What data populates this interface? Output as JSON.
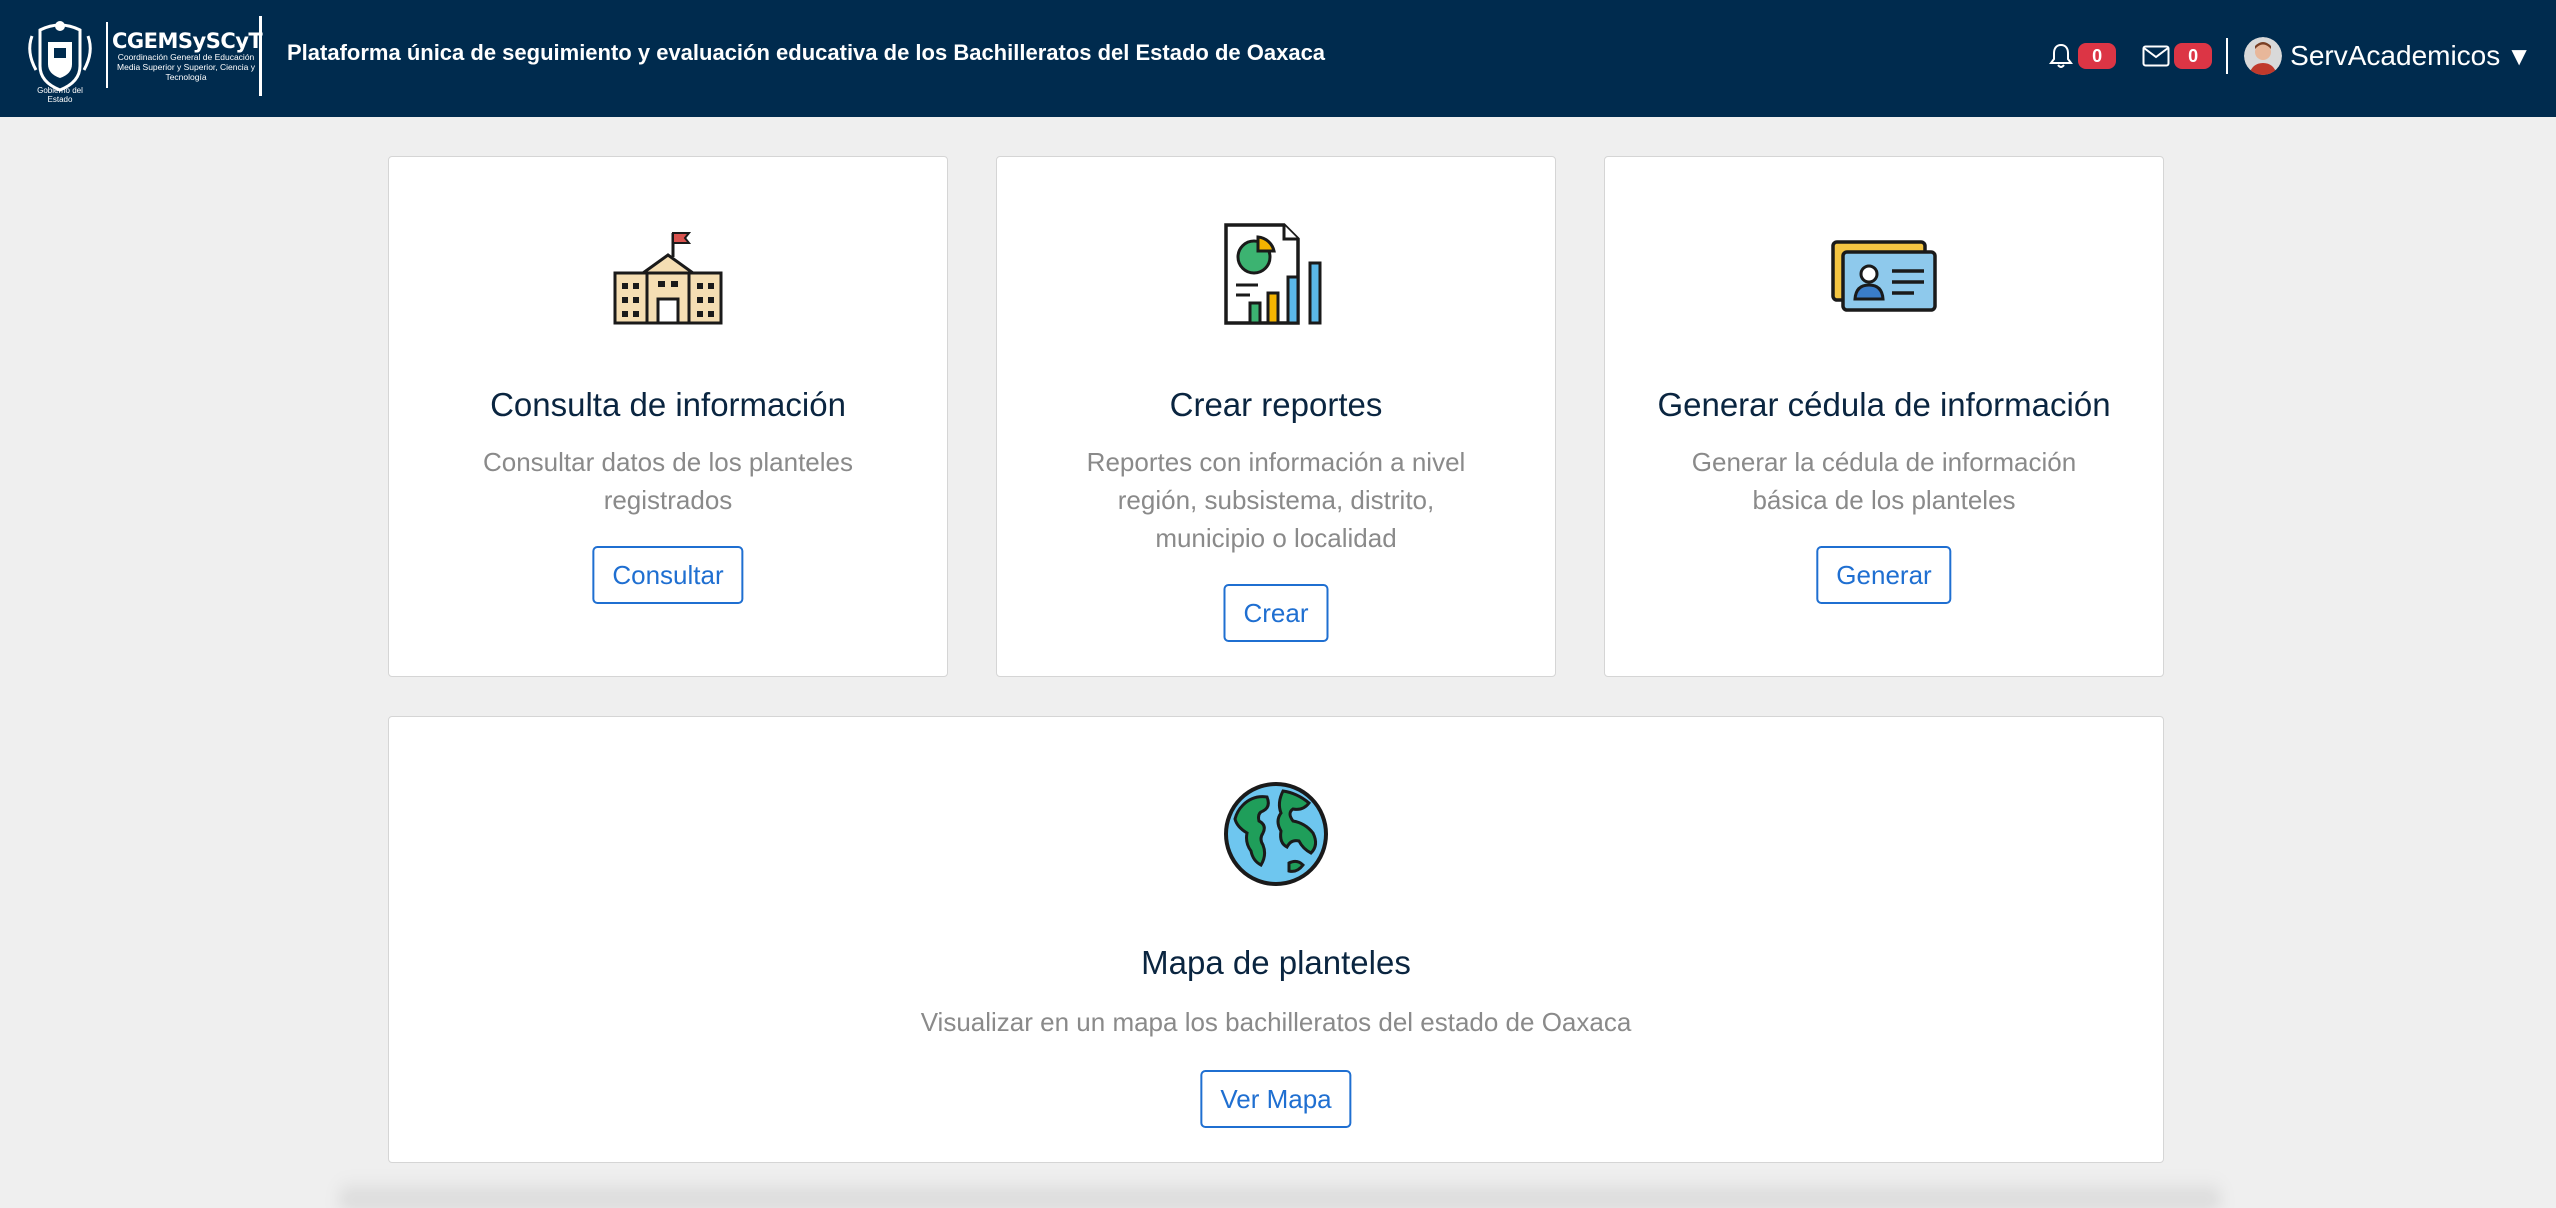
{
  "header": {
    "gov_label": "Gobierno del Estado",
    "brand_title": "CGEMSySCyT",
    "brand_subtitle": "Coordinación General de Educación Media Superior y Superior, Ciencia y Tecnología",
    "platform_title": "Plataforma única de seguimiento y evaluación educativa de los Bachilleratos del Estado de Oaxaca",
    "notifications_count": "0",
    "messages_count": "0",
    "username": "ServAcademicos",
    "caret": "▼"
  },
  "cards": [
    {
      "icon": "school-building-icon",
      "title": "Consulta de información",
      "description": "Consultar datos de los planteles registrados",
      "button": "Consultar"
    },
    {
      "icon": "report-chart-icon",
      "title": "Crear reportes",
      "description": "Reportes con información a nivel región, subsistema, distrito, municipio o localidad",
      "button": "Crear"
    },
    {
      "icon": "id-card-icon",
      "title": "Generar cédula de información",
      "description": "Generar la cédula de información básica de los planteles",
      "button": "Generar"
    },
    {
      "icon": "globe-icon",
      "title": "Mapa de planteles",
      "description": "Visualizar en un mapa los bachilleratos del estado de Oaxaca",
      "button": "Ver Mapa"
    }
  ],
  "colors": {
    "navbar": "#002b4e",
    "accent": "#1f6fd1",
    "badge": "#dc3545",
    "background": "#efefef"
  }
}
